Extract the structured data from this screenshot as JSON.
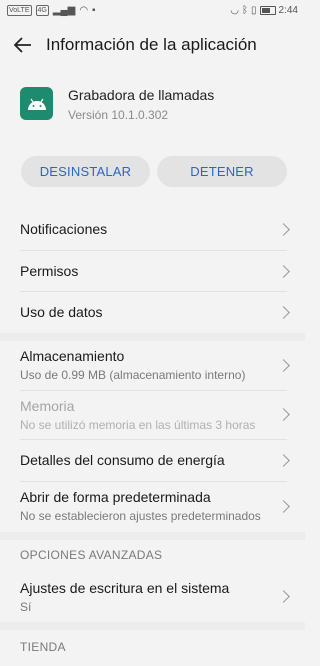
{
  "status_bar": {
    "left_chips": [
      "VoLTE",
      "4G"
    ],
    "time": "2:44"
  },
  "app_bar": {
    "title": "Información de la aplicación"
  },
  "app": {
    "name": "Grabadora de llamadas",
    "version": "Versión 10.1.0.302",
    "icon_color": "#1e8a6e"
  },
  "buttons": {
    "uninstall": "DESINSTALAR",
    "stop": "DETENER"
  },
  "items": {
    "notifications": {
      "label": "Notificaciones"
    },
    "permissions": {
      "label": "Permisos"
    },
    "data_usage": {
      "label": "Uso de datos"
    },
    "storage": {
      "label": "Almacenamiento",
      "sub": "Uso de 0.99 MB (almacenamiento interno)"
    },
    "memory": {
      "label": "Memoria",
      "sub": "No se utilizó memoria en las últimas 3 horas"
    },
    "energy": {
      "label": "Detalles del consumo de energía"
    },
    "default_open": {
      "label": "Abrir de forma predeterminada",
      "sub": "No se establecieron ajustes predeterminados"
    },
    "system_write": {
      "label": "Ajustes de escritura en el sistema",
      "sub": "Sí"
    }
  },
  "sections": {
    "advanced": "OPCIONES AVANZADAS",
    "store": "TIENDA"
  },
  "colors": {
    "accent": "#2e64c8",
    "background": "#f3f3f3"
  }
}
